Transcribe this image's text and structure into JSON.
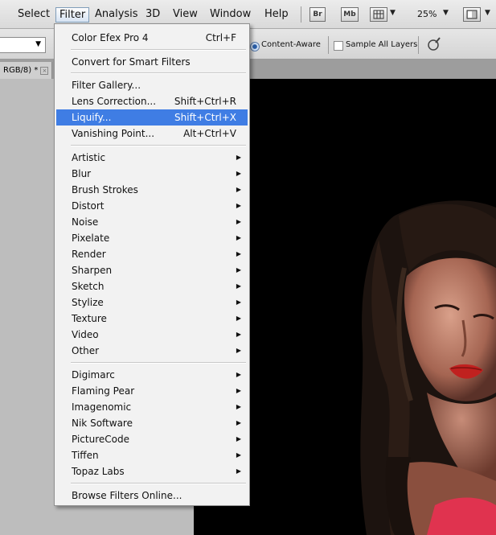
{
  "menubar": {
    "items": [
      "Select",
      "Filter",
      "Analysis",
      "3D",
      "View",
      "Window",
      "Help"
    ],
    "br_label": "Br",
    "mb_label": "Mb",
    "zoom": "25%"
  },
  "options": {
    "content_aware": "Content-Aware",
    "sample_all_layers": "Sample All Layers"
  },
  "document": {
    "tab_label": "RGB/8) *"
  },
  "filter_menu": {
    "last_filter": {
      "label": "Color Efex Pro 4",
      "shortcut": "Ctrl+F"
    },
    "convert_smart": "Convert for Smart Filters",
    "special": [
      {
        "label": "Filter Gallery...",
        "shortcut": ""
      },
      {
        "label": "Lens Correction...",
        "shortcut": "Shift+Ctrl+R"
      },
      {
        "label": "Liquify...",
        "shortcut": "Shift+Ctrl+X"
      },
      {
        "label": "Vanishing Point...",
        "shortcut": "Alt+Ctrl+V"
      }
    ],
    "groups": [
      "Artistic",
      "Blur",
      "Brush Strokes",
      "Distort",
      "Noise",
      "Pixelate",
      "Render",
      "Sharpen",
      "Sketch",
      "Stylize",
      "Texture",
      "Video",
      "Other"
    ],
    "plugins": [
      "Digimarc",
      "Flaming Pear",
      "Imagenomic",
      "Nik Software",
      "PictureCode",
      "Tiffen",
      "Topaz Labs"
    ],
    "browse": "Browse Filters Online..."
  },
  "colors": {
    "highlight": "#3f7de4",
    "menu_bg": "#f2f2f2",
    "canvas_bg": "#bdbdbd"
  }
}
